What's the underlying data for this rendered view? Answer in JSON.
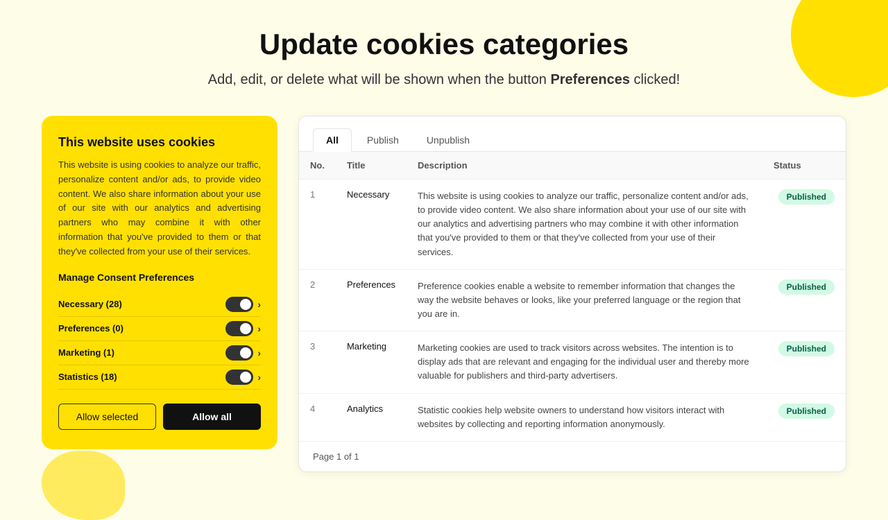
{
  "page": {
    "title": "Update cookies categories",
    "subtitle_prefix": "Add, edit, or delete what will be shown when the button ",
    "subtitle_bold": "Preferences",
    "subtitle_suffix": " clicked!"
  },
  "cookie_card": {
    "title": "This website uses cookies",
    "description": "This website is using cookies to analyze our traffic, personalize content and/or ads, to provide video content. We also share information about your use of our site with our analytics and advertising partners who may combine it with other information that you've provided to them or that they've collected from your use of their services.",
    "manage_title": "Manage Consent Preferences",
    "items": [
      {
        "label": "Necessary (28)"
      },
      {
        "label": "Preferences (0)"
      },
      {
        "label": "Marketing (1)"
      },
      {
        "label": "Statistics (18)"
      }
    ],
    "btn_allow_selected": "Allow selected",
    "btn_allow_all": "Allow all"
  },
  "table": {
    "tabs": [
      {
        "label": "All",
        "active": true
      },
      {
        "label": "Publish",
        "active": false
      },
      {
        "label": "Unpublish",
        "active": false
      }
    ],
    "columns": [
      {
        "key": "no",
        "label": "No."
      },
      {
        "key": "title",
        "label": "Title"
      },
      {
        "key": "description",
        "label": "Description"
      },
      {
        "key": "status",
        "label": "Status"
      }
    ],
    "rows": [
      {
        "no": "1",
        "title": "Necessary",
        "description": "This website is using cookies to analyze our traffic, personalize content and/or ads, to provide video content. We also share information about your use of our site with our analytics and advertising partners who may combine it with other information that you've provided to them or that they've collected from your use of their services.",
        "status": "Published"
      },
      {
        "no": "2",
        "title": "Preferences",
        "description": "Preference cookies enable a website to remember information that changes the way the website behaves or looks, like your preferred language or the region that you are in.",
        "status": "Published"
      },
      {
        "no": "3",
        "title": "Marketing",
        "description": "Marketing cookies are used to track visitors across websites. The intention is to display ads that are relevant and engaging for the individual user and thereby more valuable for publishers and third-party advertisers.",
        "status": "Published"
      },
      {
        "no": "4",
        "title": "Analytics",
        "description": "Statistic cookies help website owners to understand how visitors interact with websites by collecting and reporting information anonymously.",
        "status": "Published"
      }
    ],
    "pagination": "Page 1 of 1"
  }
}
